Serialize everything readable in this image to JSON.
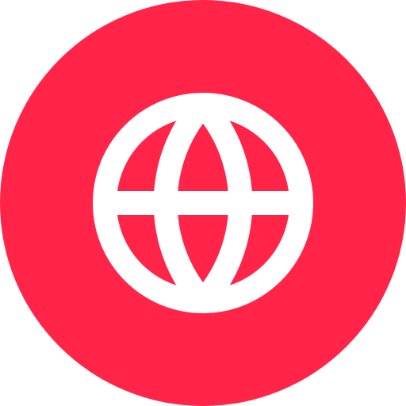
{
  "app_icon": {
    "icon": "globe-icon",
    "background_color": "#ff2448",
    "foreground_color": "#ffffff"
  }
}
